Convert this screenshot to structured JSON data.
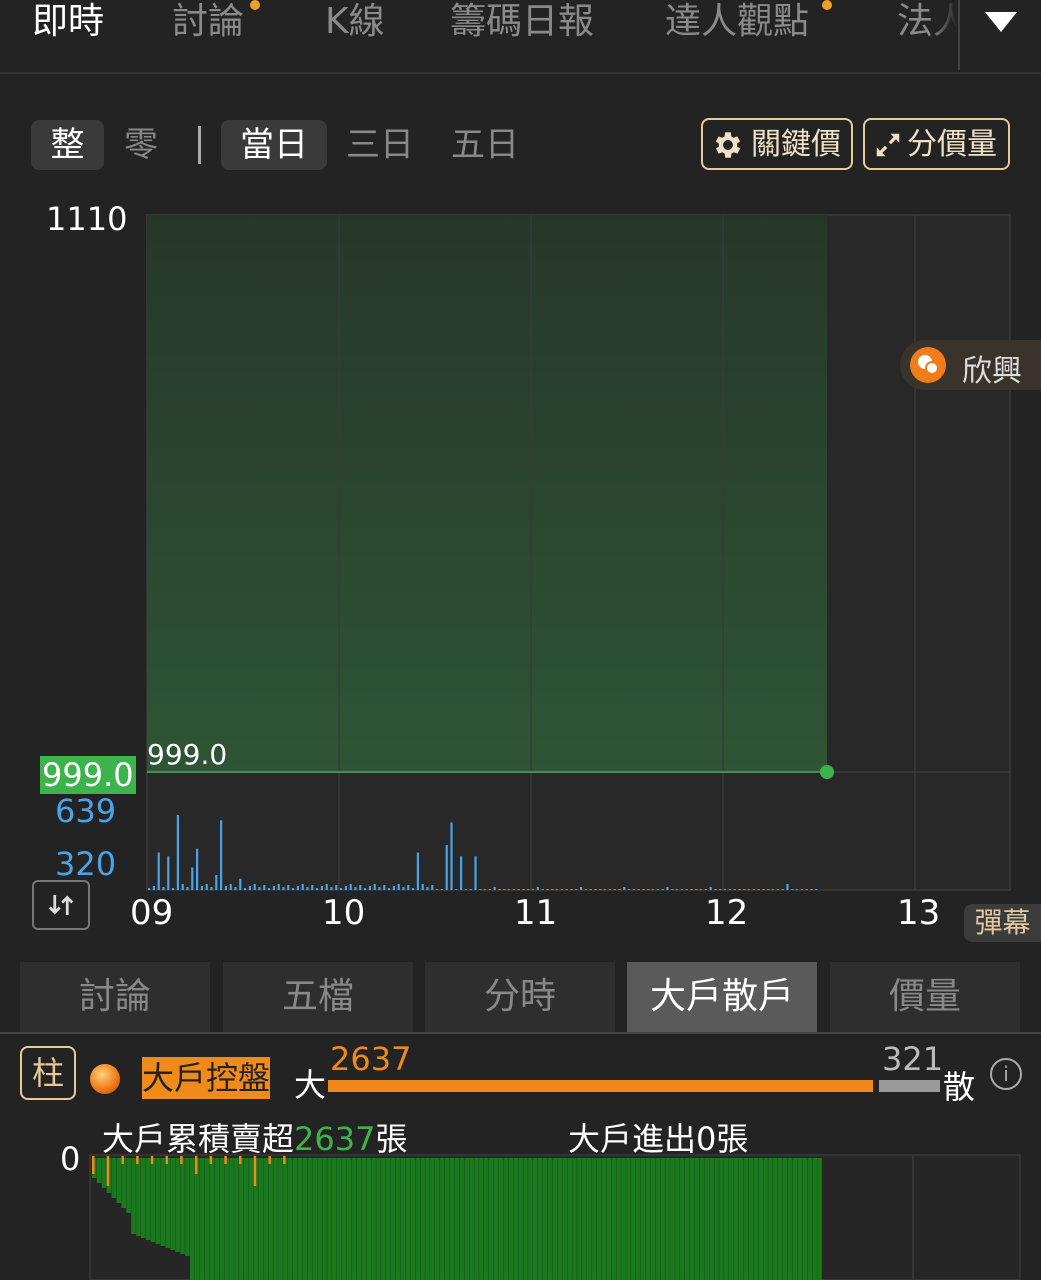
{
  "top_tabs": [
    {
      "label": "即時",
      "active": true
    },
    {
      "label": "討論",
      "badge": true
    },
    {
      "label": "K線"
    },
    {
      "label": "籌碼日報"
    },
    {
      "label": "達人觀點",
      "badge": true
    },
    {
      "label": "法人"
    }
  ],
  "controls": {
    "lot_whole": "整",
    "lot_odd": "零",
    "period_today": "當日",
    "period_3d": "三日",
    "period_5d": "五日",
    "key_price": "關鍵價",
    "price_volume": "分價量"
  },
  "chart": {
    "y_top_label": "1110",
    "current_price_label": "999.0",
    "current_price_tag": "999.0",
    "vol_high": "639",
    "vol_mid": "320",
    "x_labels": [
      "09",
      "10",
      "11",
      "12",
      "13"
    ],
    "badge_text": "欣興",
    "danmu": "彈幕"
  },
  "chart_data": {
    "type": "area",
    "x": [
      "09:00",
      "12:30"
    ],
    "y": [
      999.0,
      999.0
    ],
    "ylim": [
      999.0,
      1110
    ],
    "x_ticks": [
      "09",
      "10",
      "11",
      "12",
      "13"
    ],
    "volume": {
      "type": "bar",
      "max_labels": [
        639,
        320
      ]
    }
  },
  "bottom_tabs": [
    {
      "label": "討論"
    },
    {
      "label": "五檔"
    },
    {
      "label": "分時"
    },
    {
      "label": "大戶散戶",
      "active": true
    },
    {
      "label": "價量"
    }
  ],
  "big_player": {
    "chart_type_btn": "柱",
    "control_tag": "大戶控盤",
    "big_label": "大",
    "big_value": "2637",
    "small_value": "321",
    "small_label": "散",
    "info": "i",
    "cum_prefix": "大戶累積賣超",
    "cum_value": "2637",
    "cum_unit": "張",
    "inout": "大戶進出0張",
    "zero": "0"
  },
  "colors": {
    "bg": "#232323",
    "accent": "#f0891a",
    "price_green": "#3cb44b",
    "volume_blue": "#4aa3e6",
    "gold_border": "#e7c99a"
  }
}
